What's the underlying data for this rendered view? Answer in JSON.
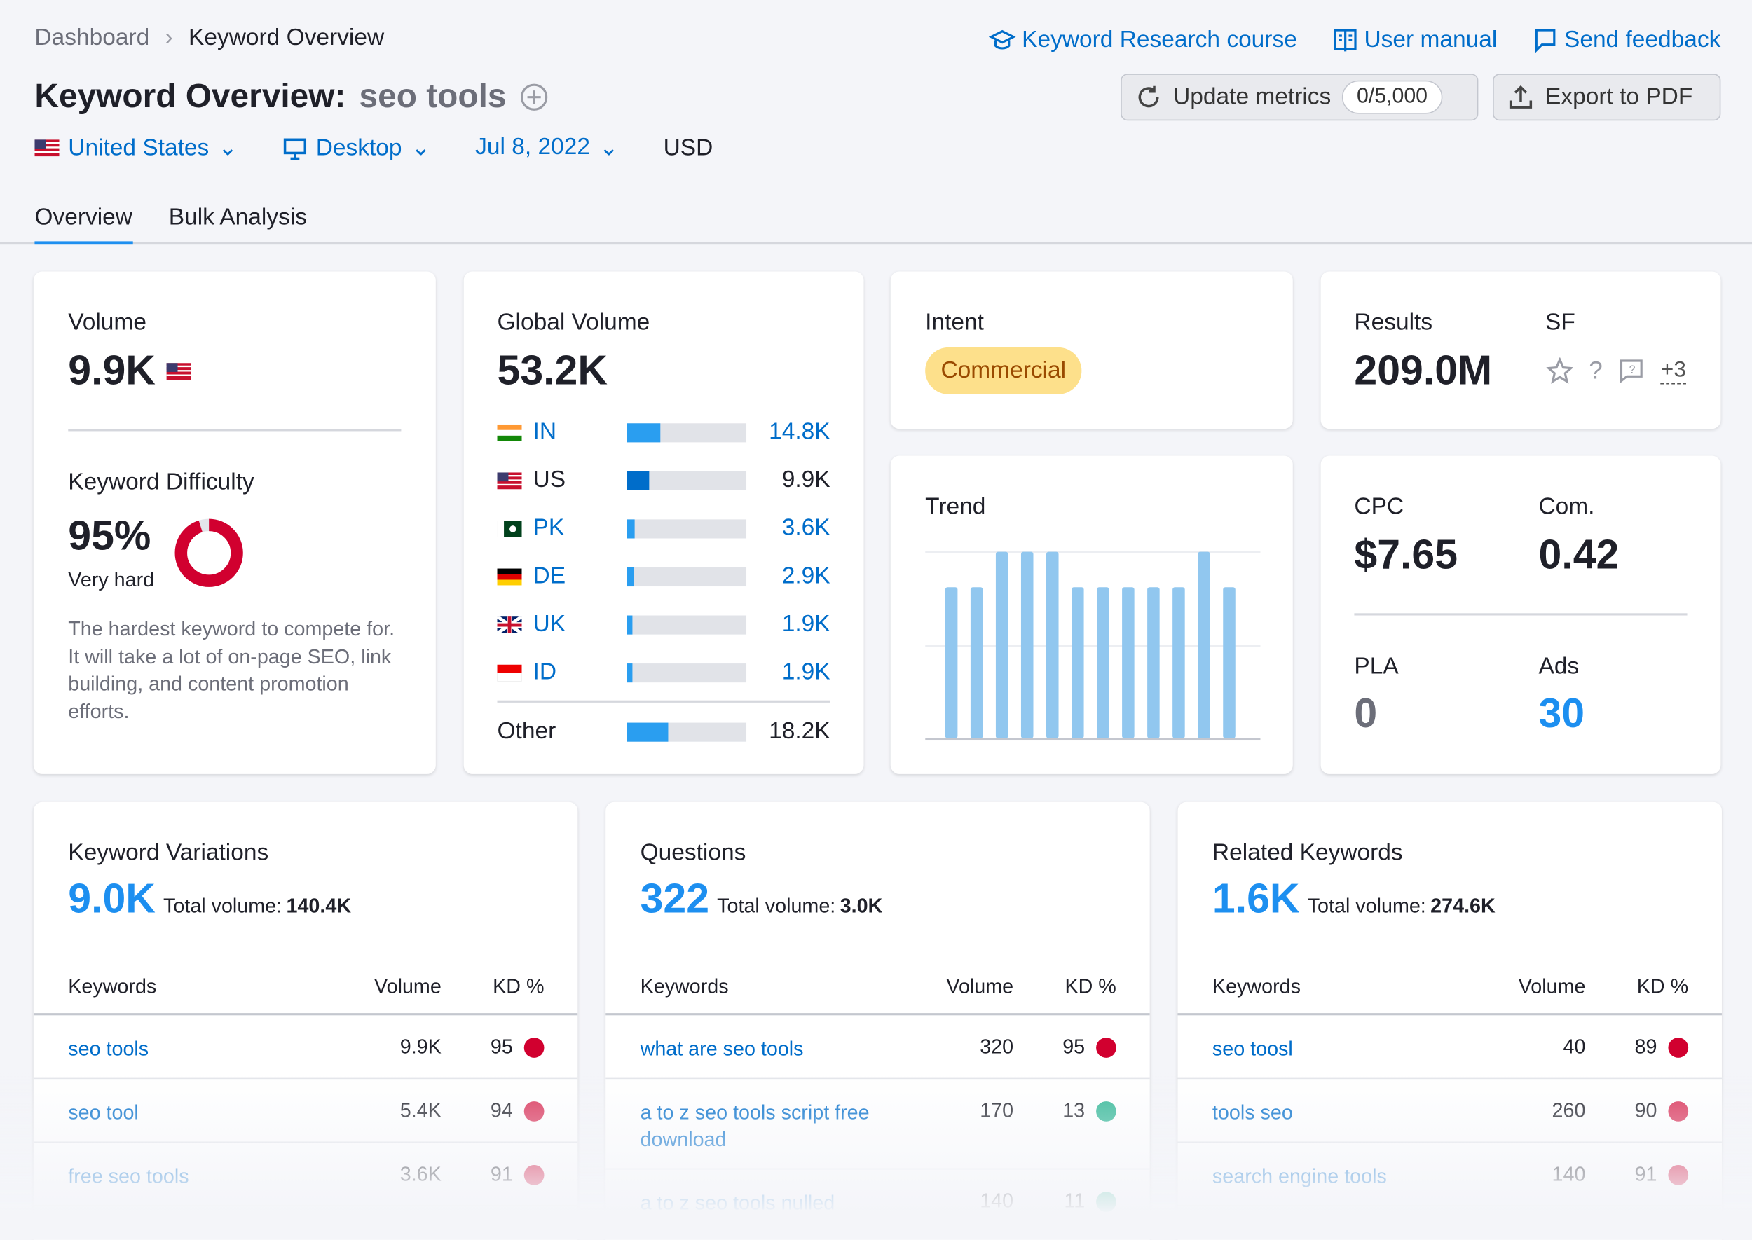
{
  "breadcrumb": {
    "home": "Dashboard",
    "current": "Keyword Overview"
  },
  "header_links": {
    "course": "Keyword Research course",
    "manual": "User manual",
    "feedback": "Send feedback"
  },
  "title": {
    "prefix": "Keyword Overview:",
    "keyword": "seo tools"
  },
  "actions": {
    "update": "Update metrics",
    "update_count": "0/5,000",
    "export": "Export to PDF"
  },
  "filters": {
    "country": "United States",
    "device": "Desktop",
    "date": "Jul 8, 2022",
    "currency": "USD"
  },
  "tabs": [
    {
      "label": "Overview",
      "active": true
    },
    {
      "label": "Bulk Analysis",
      "active": false
    }
  ],
  "volume": {
    "label": "Volume",
    "value": "9.9K"
  },
  "kd": {
    "label": "Keyword Difficulty",
    "value": "95%",
    "percent": 95,
    "level": "Very hard",
    "description": "The hardest keyword to compete for. It will take a lot of on-page SEO, link building, and content promotion efforts.",
    "color": "#d1002f"
  },
  "global_volume": {
    "label": "Global Volume",
    "value": "53.2K",
    "countries": [
      {
        "code": "IN",
        "value": "14.8K",
        "share": 0.278,
        "link": true
      },
      {
        "code": "US",
        "value": "9.9K",
        "share": 0.186,
        "link": false
      },
      {
        "code": "PK",
        "value": "3.6K",
        "share": 0.068,
        "link": true
      },
      {
        "code": "DE",
        "value": "2.9K",
        "share": 0.055,
        "link": true
      },
      {
        "code": "UK",
        "value": "1.9K",
        "share": 0.036,
        "link": true
      },
      {
        "code": "ID",
        "value": "1.9K",
        "share": 0.036,
        "link": true
      }
    ],
    "other": {
      "label": "Other",
      "value": "18.2K",
      "share": 0.342
    }
  },
  "intent": {
    "label": "Intent",
    "value": "Commercial"
  },
  "results": {
    "label": "Results",
    "value": "209.0M",
    "sf_label": "SF",
    "sf_more": "+3"
  },
  "trend": {
    "label": "Trend",
    "values": [
      0.81,
      0.81,
      1,
      1,
      1,
      0.81,
      0.81,
      0.81,
      0.81,
      0.81,
      1,
      0.81
    ]
  },
  "cpc": {
    "label": "CPC",
    "value": "$7.65",
    "com_label": "Com.",
    "com_value": "0.42",
    "pla_label": "PLA",
    "pla_value": "0",
    "ads_label": "Ads",
    "ads_value": "30"
  },
  "panels": [
    {
      "title": "Keyword Variations",
      "count": "9.0K",
      "total_label": "Total volume:",
      "total": "140.4K",
      "headers": [
        "Keywords",
        "Volume",
        "KD %"
      ],
      "rows": [
        {
          "kw": "seo tools",
          "vol": "9.9K",
          "kd": "95",
          "color": "#d1002f"
        },
        {
          "kw": "seo tool",
          "vol": "5.4K",
          "kd": "94",
          "color": "#d1002f"
        },
        {
          "kw": "free seo tools",
          "vol": "3.6K",
          "kd": "91",
          "color": "#d1002f"
        }
      ]
    },
    {
      "title": "Questions",
      "count": "322",
      "total_label": "Total volume:",
      "total": "3.0K",
      "headers": [
        "Keywords",
        "Volume",
        "KD %"
      ],
      "rows": [
        {
          "kw": "what are seo tools",
          "vol": "320",
          "kd": "95",
          "color": "#d1002f"
        },
        {
          "kw": "a to z seo tools script free download",
          "vol": "170",
          "kd": "13",
          "color": "#31b796"
        },
        {
          "kw": "a to z seo tools nulled",
          "vol": "140",
          "kd": "11",
          "color": "#31b796"
        }
      ]
    },
    {
      "title": "Related Keywords",
      "count": "1.6K",
      "total_label": "Total volume:",
      "total": "274.6K",
      "headers": [
        "Keywords",
        "Volume",
        "KD %"
      ],
      "rows": [
        {
          "kw": "seo toosl",
          "vol": "40",
          "kd": "89",
          "color": "#d1002f"
        },
        {
          "kw": "tools seo",
          "vol": "260",
          "kd": "90",
          "color": "#d1002f"
        },
        {
          "kw": "search engine tools",
          "vol": "140",
          "kd": "91",
          "color": "#d1002f"
        }
      ]
    }
  ]
}
